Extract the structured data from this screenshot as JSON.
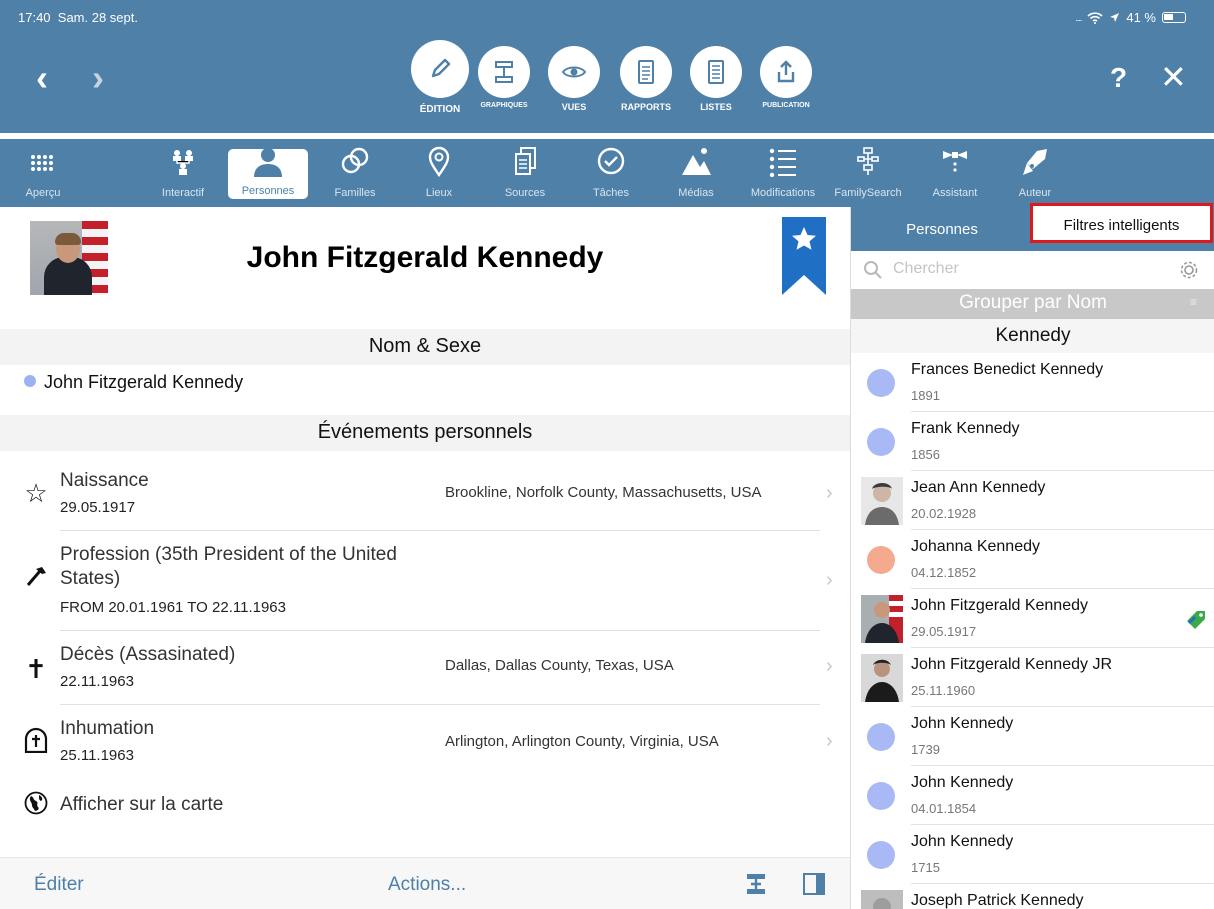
{
  "status": {
    "time": "17:40",
    "date": "Sam. 28 sept.",
    "battery": "41 %"
  },
  "modes": [
    {
      "label": "ÉDITION",
      "icon": "pencil-icon",
      "active": true
    },
    {
      "label": "GRAPHIQUES",
      "icon": "chart-tree-icon"
    },
    {
      "label": "VUES",
      "icon": "eye-icon"
    },
    {
      "label": "RAPPORTS",
      "icon": "document-icon"
    },
    {
      "label": "LISTES",
      "icon": "list-document-icon"
    },
    {
      "label": "PUBLICATION",
      "icon": "share-upload-icon"
    }
  ],
  "header": {
    "help": "?",
    "close": "✕"
  },
  "toolbar": [
    {
      "label": "Aperçu",
      "icon": "grid-icon"
    },
    {
      "label": "Interactif",
      "icon": "family-tree-icon"
    },
    {
      "label": "Personnes",
      "icon": "person-icon",
      "active": true
    },
    {
      "label": "Familles",
      "icon": "rings-icon"
    },
    {
      "label": "Lieux",
      "icon": "map-pin-icon"
    },
    {
      "label": "Sources",
      "icon": "sources-icon"
    },
    {
      "label": "Tâches",
      "icon": "checkmark-icon"
    },
    {
      "label": "Médias",
      "icon": "media-icon"
    },
    {
      "label": "Modifications",
      "icon": "list-icon"
    },
    {
      "label": "FamilySearch",
      "icon": "familysearch-tree-icon"
    },
    {
      "label": "Assistant",
      "icon": "bowtie-icon"
    },
    {
      "label": "Auteur",
      "icon": "pen-nib-icon"
    }
  ],
  "person": {
    "name": "John Fitzgerald Kennedy",
    "name_section": "Nom & Sexe",
    "name_value": "John Fitzgerald Kennedy",
    "events_section": "Événements personnels",
    "events": [
      {
        "icon": "star-icon",
        "title": "Naissance",
        "date": "29.05.1917",
        "place": "Brookline, Norfolk County, Massachusetts, USA"
      },
      {
        "icon": "hammer-icon",
        "title": "Profession (35th President of the United States)",
        "date": "FROM 20.01.1961 TO 22.11.1963",
        "place": ""
      },
      {
        "icon": "cross-icon",
        "title": "Décès (Assasinated)",
        "date": "22.11.1963",
        "place": "Dallas, Dallas County, Texas, USA"
      },
      {
        "icon": "tombstone-icon",
        "title": "Inhumation",
        "date": "25.11.1963",
        "place": "Arlington, Arlington County, Virginia, USA"
      }
    ],
    "map_link": "Afficher sur la carte"
  },
  "bottom": {
    "edit": "Éditer",
    "actions": "Actions..."
  },
  "sidebar": {
    "tab1": "Personnes",
    "tab2": "Filtres intelligents",
    "search_placeholder": "Chercher",
    "group_by": "Grouper par Nom",
    "group_name": "Kennedy",
    "items": [
      {
        "name": "Frances Benedict Kennedy",
        "date": "1891",
        "avatar": "dot",
        "color": "#a9b9f5"
      },
      {
        "name": "Frank Kennedy",
        "date": "1856",
        "avatar": "dot",
        "color": "#a9b9f5"
      },
      {
        "name": "Jean Ann Kennedy",
        "date": "20.02.1928",
        "avatar": "photo-woman"
      },
      {
        "name": "Johanna Kennedy",
        "date": "04.12.1852",
        "avatar": "dot",
        "color": "#f5aa8f"
      },
      {
        "name": "John Fitzgerald Kennedy",
        "date": "29.05.1917",
        "avatar": "photo-jfk",
        "tag": true
      },
      {
        "name": "John Fitzgerald Kennedy JR",
        "date": "25.11.1960",
        "avatar": "photo-jr"
      },
      {
        "name": "John Kennedy",
        "date": "1739",
        "avatar": "dot",
        "color": "#a9b9f5"
      },
      {
        "name": "John Kennedy",
        "date": "04.01.1854",
        "avatar": "dot",
        "color": "#a9b9f5"
      },
      {
        "name": "John Kennedy",
        "date": "1715",
        "avatar": "dot",
        "color": "#a9b9f5"
      },
      {
        "name": "Joseph Patrick Kennedy",
        "date": "",
        "avatar": "photo-joseph"
      }
    ]
  },
  "colors": {
    "brand_blue": "#4e80a8",
    "highlight_red": "#e0181b",
    "accent_blue": "#1f6fc5"
  }
}
